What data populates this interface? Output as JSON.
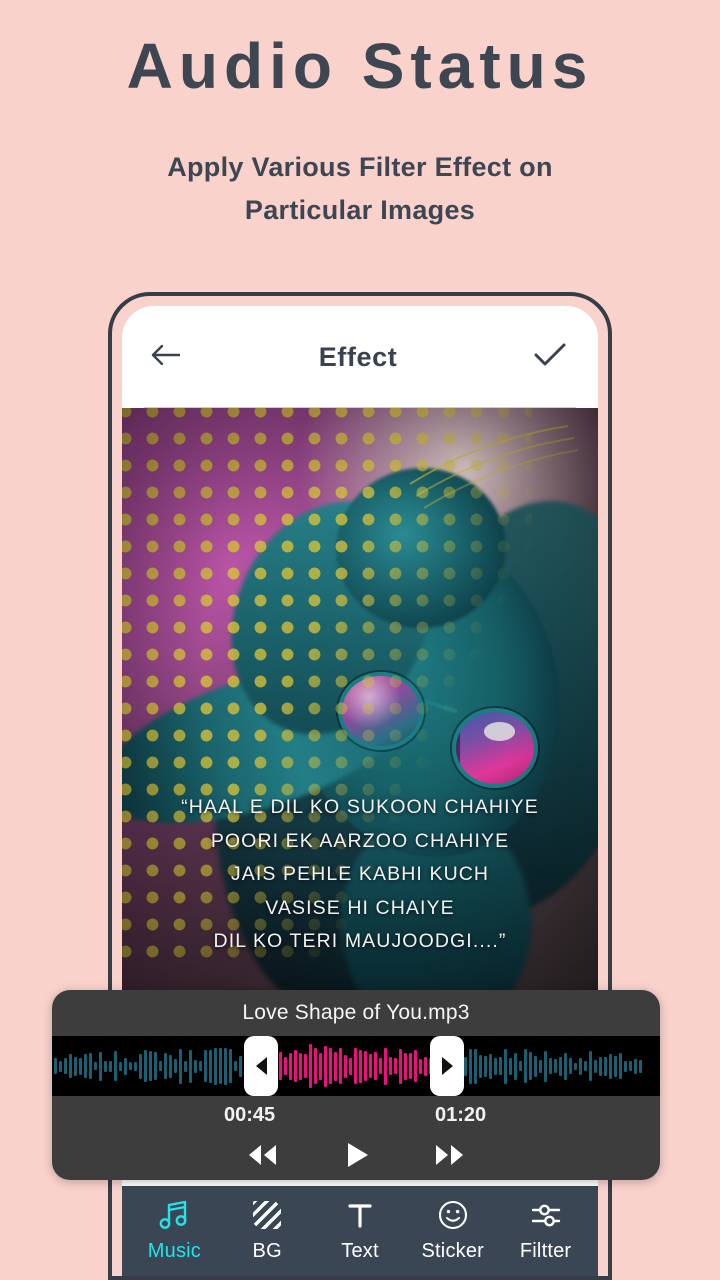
{
  "promo": {
    "title": "Audio Status",
    "subtitle": "Apply Various Filter Effect on Particular Images"
  },
  "appbar": {
    "back_icon": "arrow-left-icon",
    "title": "Effect",
    "confirm_icon": "check-icon"
  },
  "canvas": {
    "lyrics_lines": [
      "“HAAL E DIL KO SUKOON CHAHIYE",
      "POORI EK AARZOO CHAHIYE",
      "JAIS PEHLE KABHI KUCH",
      "VASISE HI CHAIYE",
      "DIL KO TERI MAUJOODGI....”"
    ]
  },
  "player": {
    "track_title": "Love Shape of You.mp3",
    "start_time": "00:45",
    "end_time": "01:20",
    "waveform": {
      "selection_color": "#ec0f7e",
      "unselected_color": "#1b5f73",
      "background": "#000000"
    },
    "controls": {
      "rewind": "rewind-icon",
      "play": "play-icon",
      "forward": "fast-forward-icon"
    },
    "handles": {
      "left": "trim-handle-left",
      "right": "trim-handle-right"
    }
  },
  "tabbar": {
    "active_color": "#24e3e8",
    "inactive_color": "#ffffff",
    "items": [
      {
        "id": "music",
        "label": "Music",
        "icon": "music-note-icon",
        "active": true
      },
      {
        "id": "bg",
        "label": "BG",
        "icon": "hatch-square-icon",
        "active": false
      },
      {
        "id": "text",
        "label": "Text",
        "icon": "text-t-icon",
        "active": false
      },
      {
        "id": "sticker",
        "label": "Sticker",
        "icon": "smiley-icon",
        "active": false
      },
      {
        "id": "filter",
        "label": "Filtter",
        "icon": "sliders-icon",
        "active": false
      }
    ]
  },
  "theme": {
    "background": "#fad2cc",
    "heading_color": "#3e4652",
    "phone_frame": "#363d49",
    "player_panel": "#3d3d3d",
    "tabbar": "#3b4654"
  }
}
